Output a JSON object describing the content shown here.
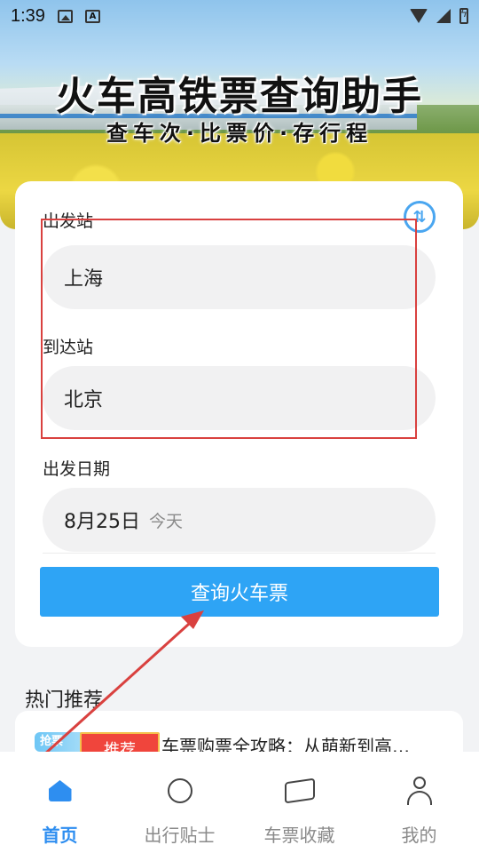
{
  "status_bar": {
    "time": "1:39"
  },
  "hero": {
    "title": "火车高铁票查询助手",
    "subtitle": "查车次·比票价·存行程"
  },
  "search": {
    "departure_label": "出发站",
    "departure_value": "上海",
    "arrival_label": "到达站",
    "arrival_value": "北京",
    "date_label": "出发日期",
    "date_value": "8月25日",
    "date_hint": "今天",
    "query_button": "查询火车票"
  },
  "hot": {
    "section_title": "热门推荐",
    "item": {
      "thumb_text": "抢票",
      "title": "车票购票全攻略：从萌新到高…",
      "tag": "推荐"
    }
  },
  "nav": {
    "items": [
      {
        "label": "首页",
        "icon": "home-icon",
        "active": true
      },
      {
        "label": "出行贴士",
        "icon": "lightbulb-icon",
        "active": false
      },
      {
        "label": "车票收藏",
        "icon": "ticket-icon",
        "active": false
      },
      {
        "label": "我的",
        "icon": "user-icon",
        "active": false
      }
    ]
  },
  "colors": {
    "accent": "#2ea4f5",
    "nav_active": "#2e8ef0",
    "highlight": "#d9413f",
    "tag": "#f0453c"
  }
}
